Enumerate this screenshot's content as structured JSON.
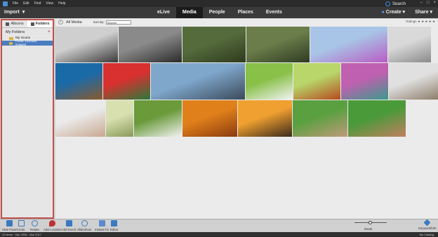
{
  "menu": [
    "File",
    "Edit",
    "Find",
    "View",
    "Help"
  ],
  "topbar": {
    "import_label": "Import",
    "tabs": [
      "eLive",
      "Media",
      "People",
      "Places",
      "Events"
    ],
    "active_tab": "Media",
    "search_label": "Search",
    "create_label": "Create",
    "share_label": "Share"
  },
  "left_panel": {
    "albums_tab": "Albums",
    "folders_tab": "Folders",
    "my_folders": "My Folders",
    "folders": [
      "My Scans",
      "Public Domain Images"
    ]
  },
  "media": {
    "breadcrumb": "All Media",
    "sort_label": "Sort By:",
    "sort_value": "Newest",
    "ratings_label": "Ratings",
    "photos": [
      {
        "name": "photo-speed-skater",
        "colors": [
          "#cfcfcf",
          "#3a3a3a"
        ]
      },
      {
        "name": "photo-hurdlers",
        "colors": [
          "#8a8a8a",
          "#2b2b2b"
        ]
      },
      {
        "name": "photo-forest-1",
        "colors": [
          "#556b3c",
          "#2e3a1e"
        ]
      },
      {
        "name": "photo-forest-2",
        "colors": [
          "#6a7d4a",
          "#2f3b22"
        ]
      },
      {
        "name": "photo-purple-flowers",
        "colors": [
          "#a8c4e6",
          "#b85cc4"
        ]
      },
      {
        "name": "photo-baby-teddy",
        "colors": [
          "#d9d9d9",
          "#8a8a8a"
        ]
      },
      {
        "name": "photo-sea-turtle",
        "colors": [
          "#1b6aa8",
          "#8b5a2b"
        ]
      },
      {
        "name": "photo-parrot",
        "colors": [
          "#d93030",
          "#2a7a3a"
        ]
      },
      {
        "name": "photo-mountains",
        "colors": [
          "#7fa7cc",
          "#3b4a5a"
        ]
      },
      {
        "name": "photo-owl",
        "colors": [
          "#88c048",
          "#f2f2f2"
        ]
      },
      {
        "name": "photo-red-panda",
        "colors": [
          "#b8d66a",
          "#b54a1e"
        ]
      },
      {
        "name": "photo-hummingbird",
        "colors": [
          "#c060b0",
          "#3a9a8a"
        ]
      },
      {
        "name": "photo-hedgehog",
        "colors": [
          "#e0e0e0",
          "#8a7a66"
        ]
      },
      {
        "name": "photo-baby-smile",
        "colors": [
          "#eaeaea",
          "#c9a890"
        ]
      },
      {
        "name": "photo-girl-field",
        "colors": [
          "#d8e0b0",
          "#8a9a5a"
        ]
      },
      {
        "name": "photo-lamb",
        "colors": [
          "#6a9a3a",
          "#f2f2f2"
        ]
      },
      {
        "name": "photo-autumn-trees",
        "colors": [
          "#e0801a",
          "#8a3a10"
        ]
      },
      {
        "name": "photo-sunset-runner",
        "colors": [
          "#f0a030",
          "#3a2a1a"
        ]
      },
      {
        "name": "photo-baseball-running",
        "colors": [
          "#5aa040",
          "#c09a7a"
        ]
      },
      {
        "name": "photo-baseball-slide",
        "colors": [
          "#4a9a3a",
          "#c08060"
        ]
      }
    ]
  },
  "toolbar": [
    "Hide Panel",
    "Undo",
    "Rotate",
    "Add Location",
    "Add Event",
    "Slideshow",
    "Instant Fix",
    "Editor"
  ],
  "zoom_label": "Zoom",
  "keyword_label": "Keyword/Info",
  "status": {
    "left": "20 items · Mar 2008 - Mar 2017",
    "right": "My Catalog"
  },
  "colors": {
    "accent": "#3a8ee6",
    "highlight": "#c0504d",
    "folder_selected": "#4a7cc0"
  }
}
